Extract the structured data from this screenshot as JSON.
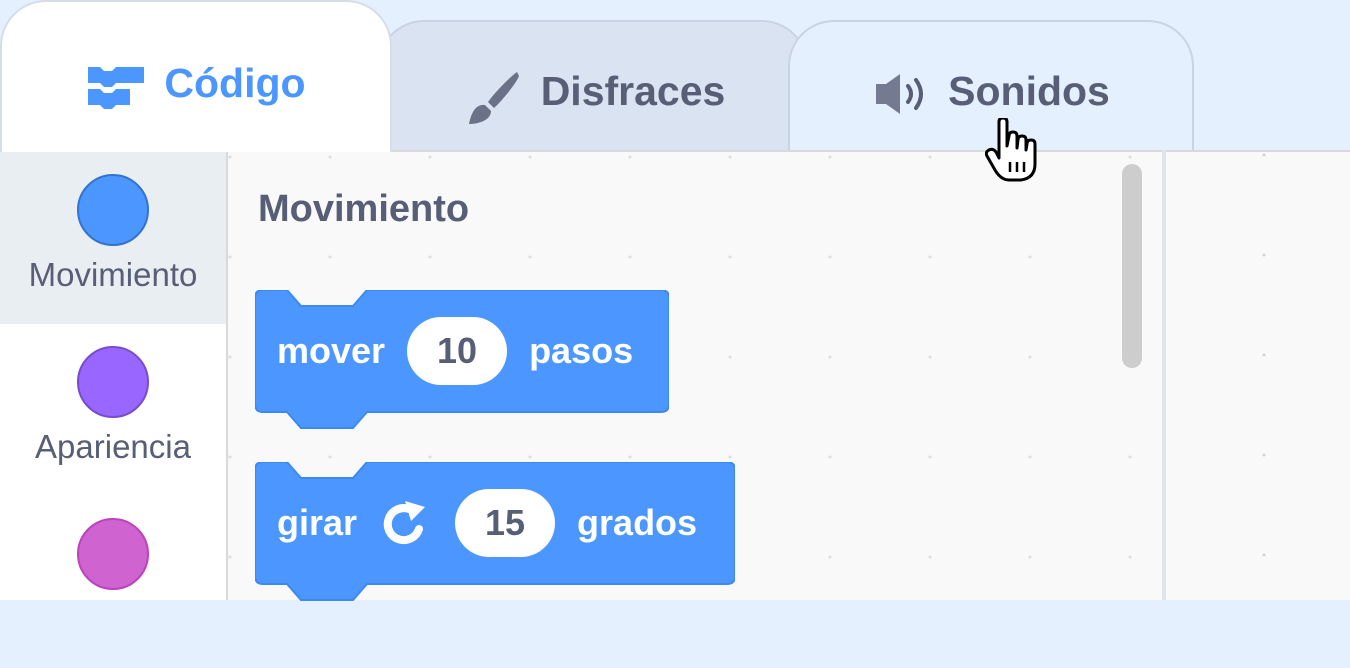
{
  "tabs": {
    "code": "Código",
    "costumes": "Disfraces",
    "sounds": "Sonidos"
  },
  "categories": [
    {
      "label": "Movimiento",
      "color": "#4c97ff",
      "selected": true
    },
    {
      "label": "Apariencia",
      "color": "#9966ff",
      "selected": false
    },
    {
      "label": "",
      "color": "#cf63cf",
      "selected": false
    }
  ],
  "palette": {
    "section_title": "Movimiento",
    "blocks": [
      {
        "text_before": "mover",
        "value": "10",
        "text_after": "pasos",
        "color": "#4c97ff"
      },
      {
        "text_before": "girar",
        "icon": "rotate-clockwise-icon",
        "value": "15",
        "text_after": "grados",
        "color": "#4c97ff"
      }
    ]
  },
  "cursor": "pointer-hand-icon"
}
